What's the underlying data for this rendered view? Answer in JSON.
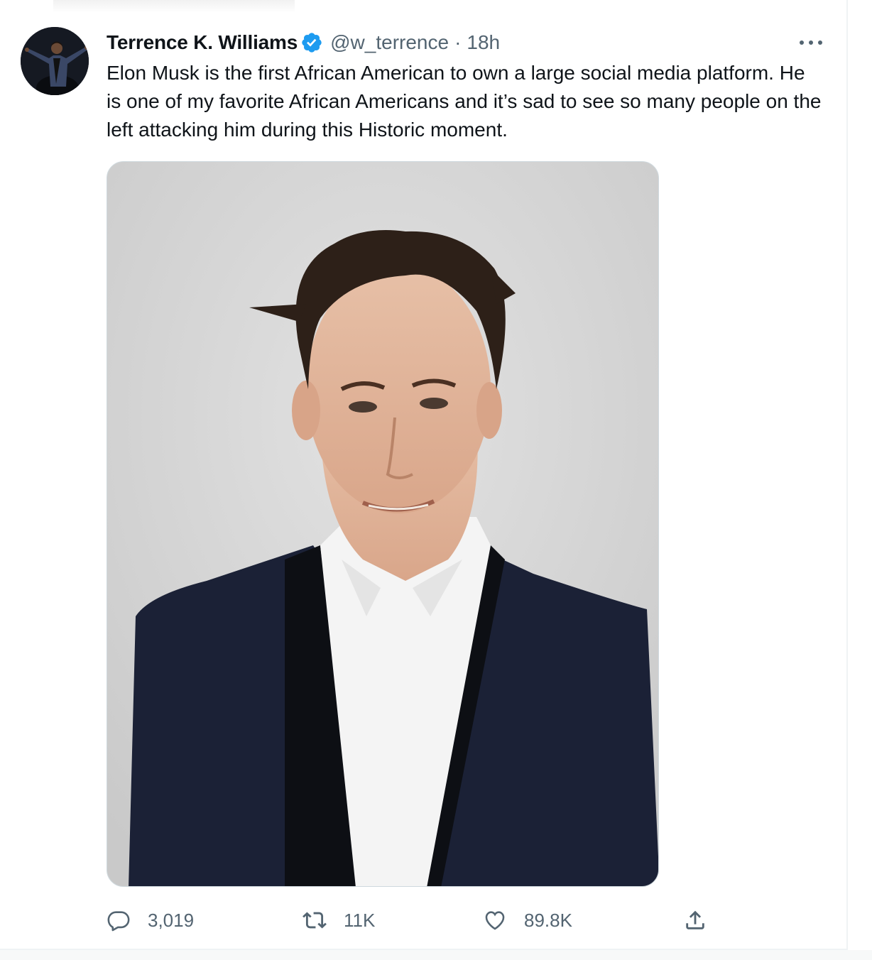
{
  "tweet": {
    "author": {
      "display_name": "Terrence K. Williams",
      "handle": "@w_terrence",
      "verified": true,
      "avatar_icon": "profile-photo"
    },
    "separator": "·",
    "timestamp": "18h",
    "text": "Elon Musk is the first African American to own a large social media platform. He is one of my favorite African Americans and it’s sad to see so many people on the left attacking him during this Historic moment.",
    "media": {
      "type": "photo"
    },
    "actions": {
      "reply": {
        "icon": "reply-icon",
        "count": "3,019"
      },
      "retweet": {
        "icon": "retweet-icon",
        "count": "11K"
      },
      "like": {
        "icon": "heart-icon",
        "count": "89.8K"
      },
      "share": {
        "icon": "share-icon"
      }
    },
    "more_icon": "more-options-icon"
  },
  "colors": {
    "text_primary": "#0f1419",
    "text_secondary": "#536471",
    "verified_blue": "#1d9bf0",
    "border": "#cfd9de"
  }
}
